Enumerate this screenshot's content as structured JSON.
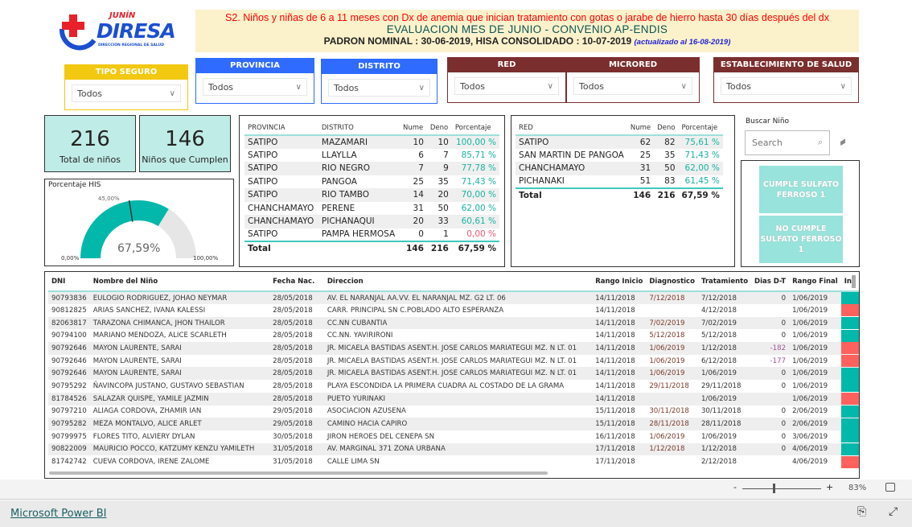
{
  "logo": {
    "text_top": "JUNÍN",
    "text_main": "DIRESA",
    "text_sub": "DIRECCIÓN REGIONAL DE SALUD"
  },
  "banner": {
    "line1": "S2. Niños y niñas de 6 a 11 meses con Dx de anemia que inician tratamiento con gotas o jarabe de hierro hasta 30 días después del dx",
    "line2": "EVALUACION  MES DE JUNIO - CONVENIO AP-ENDIS",
    "line3": "PADRON NOMINAL : 30-06-2019,  HISA CONSOLIDADO : 10-07-2019 ",
    "line3_note": "(actualizado al  16-08-2019)"
  },
  "slicers": [
    {
      "label": "TIPO SEGURO",
      "value": "Todos",
      "color": "#f2c811"
    },
    {
      "label": "PROVINCIA",
      "value": "Todos",
      "color": "#2f6bff"
    },
    {
      "label": "DISTRITO",
      "value": "Todos",
      "color": "#2f6bff"
    },
    {
      "label": "RED",
      "value": "Todos",
      "color": "#7b2e2e"
    },
    {
      "label": "MICRORED",
      "value": "Todos",
      "color": "#7b2e2e"
    },
    {
      "label": "ESTABLECIMIENTO DE SALUD",
      "value": "Todos",
      "color": "#7b2e2e"
    }
  ],
  "cards": [
    {
      "value": "216",
      "label": "Total de niños"
    },
    {
      "value": "146",
      "label": "Niños que Cumplen"
    }
  ],
  "gauge": {
    "title": "Porcentaje HIS",
    "value": 67.59,
    "value_label": "67,59%",
    "target": 45,
    "target_label": "45,00%",
    "min_label": "0,00%",
    "max_label": "100,00%",
    "fill_color": "#01b8aa"
  },
  "table_distrito": {
    "headers": [
      "PROVINCIA",
      "DISTRITO",
      "Nume",
      "Deno",
      "Porcentaje"
    ],
    "rows": [
      [
        "SATIPO",
        "MAZAMARI",
        "10",
        "10",
        "100,00 %"
      ],
      [
        "SATIPO",
        "LLAYLLA",
        "6",
        "7",
        "85,71 %"
      ],
      [
        "SATIPO",
        "RIO NEGRO",
        "7",
        "9",
        "77,78 %"
      ],
      [
        "SATIPO",
        "PANGOA",
        "25",
        "35",
        "71,43 %"
      ],
      [
        "SATIPO",
        "RIO TAMBO",
        "14",
        "20",
        "70,00 %"
      ],
      [
        "CHANCHAMAYO",
        "PERENE",
        "31",
        "50",
        "62,00 %"
      ],
      [
        "CHANCHAMAYO",
        "PICHANAQUI",
        "20",
        "33",
        "60,61 %"
      ],
      [
        "SATIPO",
        "PAMPA HERMOSA",
        "0",
        "1",
        "0,00 %"
      ]
    ],
    "total": [
      "Total",
      "",
      "146",
      "216",
      "67,59 %"
    ]
  },
  "table_red": {
    "headers": [
      "RED",
      "Nume",
      "Deno",
      "Porcentaje"
    ],
    "rows": [
      [
        "SATIPO",
        "62",
        "82",
        "75,61 %"
      ],
      [
        "SAN MARTIN DE PANGOA",
        "25",
        "35",
        "71,43 %"
      ],
      [
        "CHANCHAMAYO",
        "31",
        "50",
        "62,00 %"
      ],
      [
        "PICHANAKI",
        "51",
        "83",
        "61,45 %"
      ]
    ],
    "total": [
      "Total",
      "146",
      "216",
      "67,59 %"
    ]
  },
  "search": {
    "label": "Buscar Niño",
    "placeholder": "Search"
  },
  "buttons": {
    "cumple": "CUMPLE SULFATO FERROSO 1",
    "no_cumple": "NO CUMPLE SULFATO FERROSO 1"
  },
  "detail": {
    "headers": [
      "DNI",
      "Nombre del Niño",
      "Fecha Nac.",
      "Direccion",
      "Rango Inicio",
      "Diagnostico",
      "Tratamiento",
      "Dias D-T",
      "Rango Final",
      "Inc"
    ],
    "rows": [
      [
        "90793836",
        "EULOGIO RODRIGUEZ, JOHAO NEYMAR",
        "28/05/2018",
        "AV. EL NARANJAL AA.VV. EL NARANJAL MZ. G2 LT. 06",
        "14/11/2018",
        "7/12/2018",
        "7/12/2018",
        "0",
        "1/06/2019",
        "ok"
      ],
      [
        "90812825",
        "ARIAS SANCHEZ, IVANA KALESSI",
        "28/05/2018",
        "CARR. PRINCIPAL SN C.POBLADO ALTO ESPERANZA",
        "14/11/2018",
        "",
        "4/12/2018",
        "",
        "1/06/2019",
        "no"
      ],
      [
        "82063817",
        "TARAZONA CHIMANCA, JHON THAILOR",
        "28/05/2018",
        "CC.NN CUBANTIA",
        "14/11/2018",
        "7/02/2019",
        "7/02/2019",
        "0",
        "1/06/2019",
        "ok"
      ],
      [
        "90794100",
        "MARIANO MENDOZA, ALICE SCARLETH",
        "28/05/2018",
        "CC.NN. YAVIRIRONI",
        "14/11/2018",
        "5/12/2018",
        "5/12/2018",
        "0",
        "1/06/2019",
        "ok"
      ],
      [
        "90792646",
        "MAYON LAURENTE, SARAI",
        "28/05/2018",
        "JR. MICAELA BASTIDAS ASENT.H. JOSE CARLOS MARIATEGUI MZ. N LT. 01",
        "14/11/2018",
        "1/06/2019",
        "1/12/2018",
        "-182",
        "1/06/2019",
        "no"
      ],
      [
        "90792646",
        "MAYON LAURENTE, SARAI",
        "28/05/2018",
        "JR. MICAELA BASTIDAS ASENT.H. JOSE CARLOS MARIATEGUI MZ. N LT. 01",
        "14/11/2018",
        "1/06/2019",
        "6/12/2018",
        "-177",
        "1/06/2019",
        "no"
      ],
      [
        "90792646",
        "MAYON LAURENTE, SARAI",
        "28/05/2018",
        "JR. MICAELA BASTIDAS ASENT.H. JOSE CARLOS MARIATEGUI MZ. N LT. 01",
        "14/11/2018",
        "1/06/2019",
        "1/06/2019",
        "0",
        "1/06/2019",
        "ok"
      ],
      [
        "90795292",
        "ÑAVINCOPA JUSTANO, GUSTAVO SEBASTIAN",
        "28/05/2018",
        "PLAYA ESCONDIDA LA PRIMERA CUADRA AL COSTADO DE LA GRAMA",
        "14/11/2018",
        "29/11/2018",
        "29/11/2018",
        "0",
        "1/06/2019",
        "ok"
      ],
      [
        "81784526",
        "SALAZAR QUISPE, YAMILE JAZMIN",
        "28/05/2018",
        "PUETO YURINAKI",
        "14/11/2018",
        "",
        "1/06/2019",
        "",
        "1/06/2019",
        "no"
      ],
      [
        "90797210",
        "ALIAGA CORDOVA, ZHAMIR IAN",
        "29/05/2018",
        "ASOCIACION AZUSENA",
        "15/11/2018",
        "30/11/2018",
        "30/11/2018",
        "0",
        "2/06/2019",
        "ok"
      ],
      [
        "90795282",
        "MEZA MONTALVO, ALICE ARLET",
        "29/05/2018",
        "CAMINO HACIA CAPIRO",
        "15/11/2018",
        "28/11/2018",
        "28/11/2018",
        "0",
        "2/06/2019",
        "ok"
      ],
      [
        "90799975",
        "FLORES TITO, ALVIERY DYLAN",
        "30/05/2018",
        "JIRON HEROES DEL CENEPA SN",
        "16/11/2018",
        "1/06/2019",
        "1/06/2019",
        "0",
        "3/06/2019",
        "ok"
      ],
      [
        "90822009",
        "MAURICIO POCCO, KATZUMY KENZU YAMILETH",
        "31/05/2018",
        "AV. MARGINAL 371 ZONA URBANA",
        "17/11/2018",
        "1/12/2018",
        "1/12/2018",
        "0",
        "4/06/2019",
        "ok"
      ],
      [
        "81742742",
        "CUEVA CORDOVA, IRENE ZALOME",
        "31/05/2018",
        "CALLE LIMA SN",
        "17/11/2018",
        "",
        "2/12/2018",
        "",
        "4/06/2019",
        "no"
      ]
    ],
    "status_colors": {
      "ok": "#01b8aa",
      "no": "#fd625e"
    }
  },
  "zoom": {
    "level": "83%",
    "minus": "-",
    "plus": "+",
    "value": 83
  },
  "footer": {
    "link": "Microsoft Power BI"
  }
}
